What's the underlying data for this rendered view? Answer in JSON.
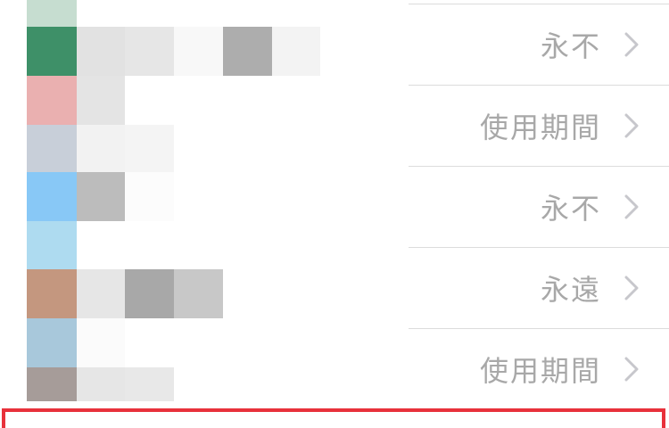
{
  "settings": {
    "rows": [
      {
        "value": "永不"
      },
      {
        "value": "使用期間"
      },
      {
        "value": "永不"
      },
      {
        "value": "永遠"
      },
      {
        "value": "使用期間"
      }
    ]
  },
  "icons": {
    "row_chevron": "chevron-right-icon"
  },
  "colors": {
    "value_text": "#a8a8a8",
    "chevron": "#c7c7cc",
    "separator": "#dcdcdc",
    "highlight": "#e8313b"
  }
}
